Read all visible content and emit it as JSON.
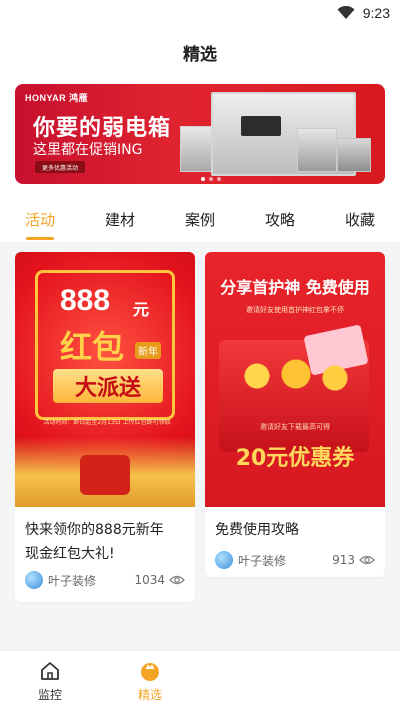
{
  "status_bar": {
    "time": "9:23"
  },
  "header": {
    "title": "精选"
  },
  "banner": {
    "brand": "HONYAR 鸿雁",
    "headline": "你要的弱电箱",
    "subline": "这里都在促销ING",
    "more_button": "更多优惠活动"
  },
  "tabs": [
    {
      "label": "活动",
      "active": true
    },
    {
      "label": "建材",
      "active": false
    },
    {
      "label": "案例",
      "active": false
    },
    {
      "label": "攻略",
      "active": false
    },
    {
      "label": "收藏",
      "active": false
    }
  ],
  "cards": [
    {
      "title_line1": "快来领你的888元新年",
      "title_line2": "现金红包大礼!",
      "author": "叶子装修",
      "views": "1034",
      "poster": {
        "amount": "888",
        "unit": "元",
        "red_text": "红包",
        "badge": "新年",
        "banner_text": "大派送",
        "small_text": "活动时间：即日起至2月13日 上传红包即可领取"
      }
    },
    {
      "title_line1": "免费使用攻略",
      "author": "叶子装修",
      "views": "913",
      "poster": {
        "heading": "分享首护神 免费使用",
        "sub": "邀请好友使用首护神红包拿不停",
        "invite": "邀请好友下载最高可得",
        "coupon": "20元优惠券"
      }
    }
  ],
  "bottom_nav": [
    {
      "label": "监控",
      "icon": "home-icon",
      "active": false
    },
    {
      "label": "精选",
      "icon": "featured-icon",
      "active": true
    }
  ],
  "colors": {
    "accent": "#f3a425",
    "primary_red": "#e0242f"
  }
}
